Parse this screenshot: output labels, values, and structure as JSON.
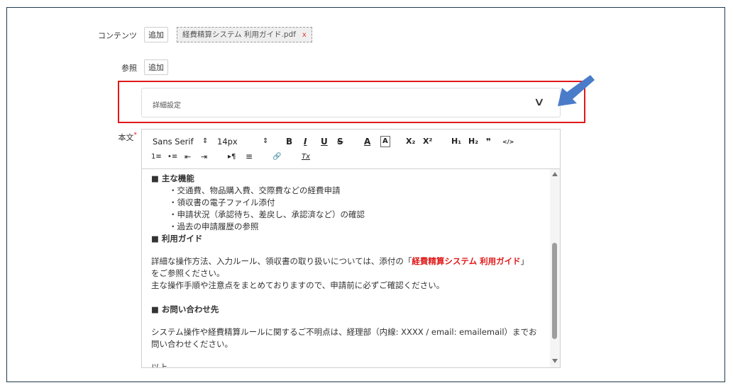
{
  "form": {
    "contents_label": "コンテンツ",
    "reference_label": "参照",
    "body_label": "本文",
    "required_mark": "*",
    "add_label": "追加",
    "attachment": {
      "name": "経費精算システム 利用ガイド.pdf",
      "remove": "x"
    }
  },
  "advanced": {
    "title": "詳細設定",
    "chevron": "∨"
  },
  "toolbar": {
    "font": "Sans Serif",
    "size": "14px",
    "select_arrow": "⇕",
    "bold": "B",
    "italic": "I",
    "underline": "U",
    "strike": "S",
    "color": "A",
    "background": "A",
    "subscript": "X₂",
    "superscript": "X²",
    "h1": "H₁",
    "h2": "H₂",
    "quote": "❞",
    "code": "</>",
    "ordered_list": "1≡",
    "bullet_list": "•≡",
    "outdent": "⇤",
    "indent": "⇥",
    "direction": "▸¶",
    "align": "≡",
    "link": "🔗",
    "clean": "Tx"
  },
  "content": {
    "features_heading": "■ 主な機能",
    "features": [
      "・交通費、物品購入費、交際費などの経費申請",
      "・領収書の電子ファイル添付",
      "・申請状況（承認待ち、差戻し、承認済など）の確認",
      "・過去の申請履歴の参照"
    ],
    "guide_heading": "■ 利用ガイド",
    "guide_p1_pre": "詳細な操作方法、入力ルール、領収書の取り扱いについては、添付の「",
    "guide_p1_link": "経費精算システム 利用ガイド",
    "guide_p1_post": "」",
    "guide_p1_line2": "をご参照ください。",
    "guide_p2": "主な操作手順や注意点をまとめておりますので、申請前に必ずご確認ください。",
    "contact_heading": "■ お問い合わせ先",
    "contact_p1": "システム操作や経費精算ルールに関するご不明点は、経理部（内線: XXXX / email: emailemail）までお",
    "contact_p2": "問い合わせください。",
    "closing": "以上"
  },
  "colors": {
    "highlight": "#e01919",
    "arrow": "#4a7cc9",
    "frame": "#1f3b4d"
  }
}
